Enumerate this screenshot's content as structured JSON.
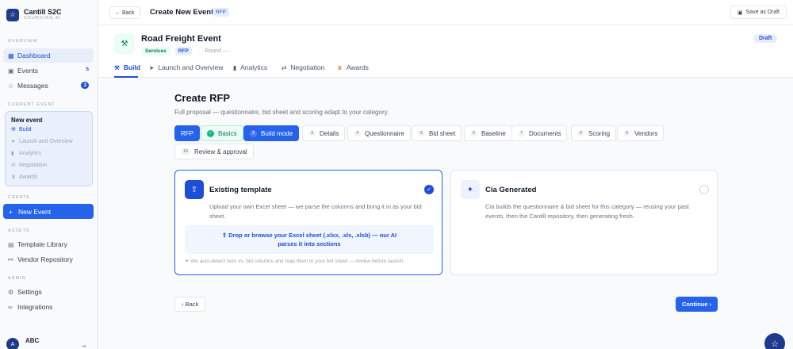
{
  "brand": {
    "name": "Cantill S2C",
    "sub": "SOURCING AI",
    "logo": "star-logo"
  },
  "sidebar": {
    "overview_label": "OVERVIEW",
    "overview": [
      {
        "label": "Dashboard",
        "icon": "dashboard-icon"
      },
      {
        "label": "Events",
        "icon": "events-icon",
        "badge": "5"
      },
      {
        "label": "Messages",
        "icon": "messages-icon",
        "badge": "3"
      }
    ],
    "current_label": "CURRENT EVENT",
    "current_title": "New event",
    "current_items": [
      "Build",
      "Launch and Overview",
      "Analytics",
      "Negotiation",
      "Awards"
    ],
    "create_label": "CREATE",
    "new_event": "New Event",
    "assets_label": "ASSETS",
    "assets": [
      "Template Library",
      "Vendor Repository"
    ],
    "admin_label": "ADMIN",
    "admin": [
      "Settings",
      "Integrations"
    ],
    "user_initial": "A",
    "user_name": "ABC"
  },
  "topbar": {
    "back": "Back",
    "title": "Create New Event",
    "tag": "RFP",
    "save": "Save as Draft"
  },
  "event": {
    "title": "Road Freight Event",
    "chip1": "Services",
    "chip2": "RFP",
    "round": "· · Round — ·",
    "status": "Draft"
  },
  "tabs": [
    "Build",
    "Launch and Overview",
    "Analytics",
    "Negotiation",
    "Awards"
  ],
  "page": {
    "title": "Create RFP",
    "subtitle": "Full proposal — questionnaire, bid sheet and scoring adapt to your category."
  },
  "steps": [
    {
      "num": "",
      "label": "RFP"
    },
    {
      "num": "✓",
      "label": "Basics"
    },
    {
      "num": "2",
      "label": "Build mode"
    },
    {
      "num": "3",
      "label": "Details"
    },
    {
      "num": "4",
      "label": "Questionnaire"
    },
    {
      "num": "5",
      "label": "Bid sheet"
    },
    {
      "num": "6",
      "label": "Baseline"
    },
    {
      "num": "7",
      "label": "Documents"
    },
    {
      "num": "8",
      "label": "Scoring"
    },
    {
      "num": "9",
      "label": "Vendors"
    },
    {
      "num": "10",
      "label": "Review & approval"
    }
  ],
  "cards": {
    "template": {
      "title": "Existing template",
      "desc": "Upload your own Excel sheet — we parse the columns and bring it in as your bid sheet.",
      "upload": "⇧ Drop or browse your Excel sheet (.xlsx, .xls, .xlsb) — our AI parses it into sections",
      "note": "✦ We auto-detect item vs. bid columns and map them to your bid sheet — review before launch."
    },
    "cia": {
      "title": "Cia Generated",
      "desc": "Cia builds the questionnaire & bid sheet for this category — reusing your past events, then the Cantill repository, then generating fresh."
    }
  },
  "footer": {
    "back": "‹ Back",
    "continue": "Continue ›"
  },
  "colors": {
    "accent": "#2563eb",
    "navy": "#1e3a8a",
    "success": "#047857"
  }
}
